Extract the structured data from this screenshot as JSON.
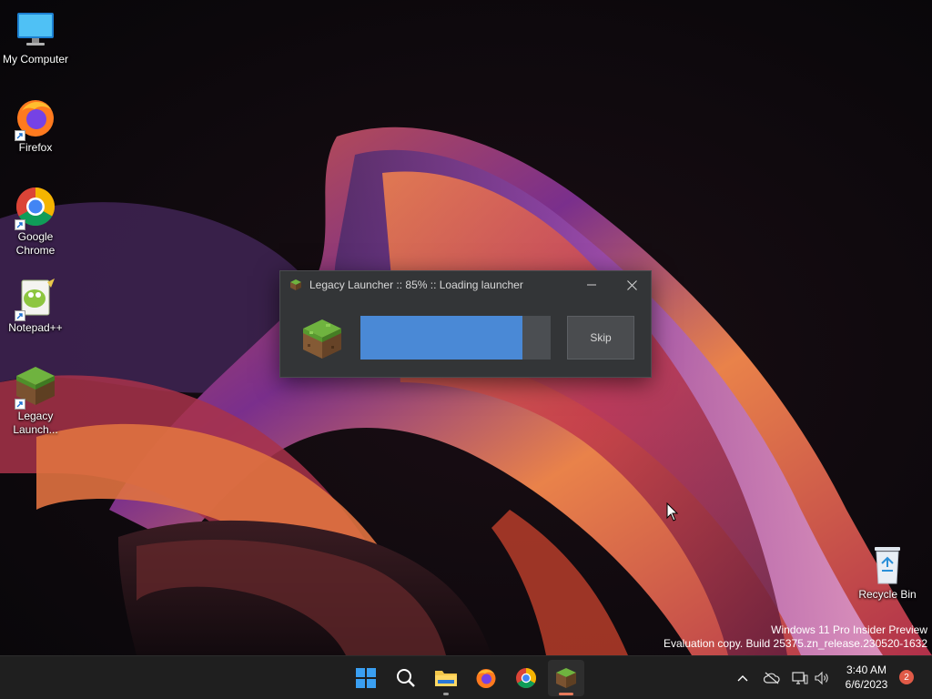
{
  "desktop": {
    "icons": [
      {
        "label": "My Computer",
        "icon": "monitor-icon"
      },
      {
        "label": "Firefox",
        "icon": "firefox-icon"
      },
      {
        "label": "Google Chrome",
        "icon": "chrome-icon"
      },
      {
        "label": "Notepad++",
        "icon": "notepadpp-icon"
      },
      {
        "label": "Legacy Launch...",
        "icon": "grass-block-icon"
      },
      {
        "label": "Recycle Bin",
        "icon": "recycle-bin-icon"
      }
    ],
    "watermark": {
      "line1": "Windows 11 Pro Insider Preview",
      "line2": "Evaluation copy. Build 25375.zn_release.230520-1632"
    }
  },
  "launcher": {
    "title": "Legacy Launcher :: 85% :: Loading launcher",
    "progress": 0.85,
    "skip_label": "Skip",
    "accent": "#4a89d6"
  },
  "taskbar": {
    "apps": [
      "start-icon",
      "search-icon",
      "file-explorer-icon",
      "firefox-icon",
      "chrome-icon",
      "legacy-launcher-icon"
    ],
    "tray": [
      "chevron-up-icon",
      "cloud-off-icon",
      "network-icon",
      "volume-icon"
    ],
    "clock": {
      "time": "3:40 AM",
      "date": "6/6/2023"
    },
    "notifications": "2"
  }
}
